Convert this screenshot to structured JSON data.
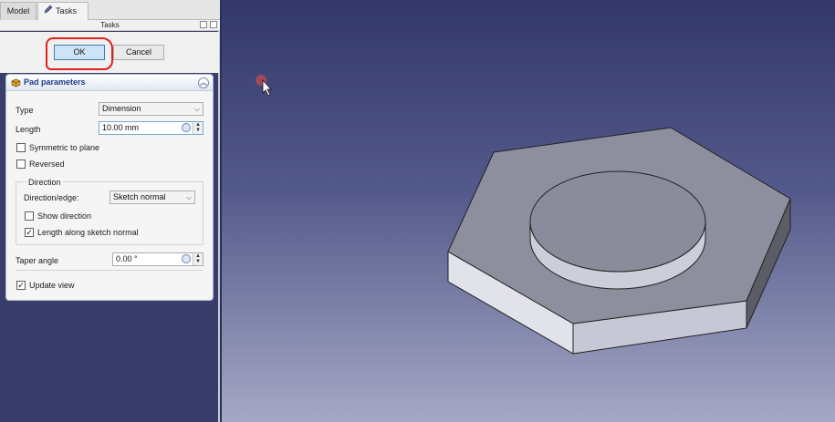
{
  "tabs": {
    "model": "Model",
    "tasks": "Tasks"
  },
  "panel": {
    "header": "Tasks"
  },
  "buttons": {
    "ok": "OK",
    "cancel": "Cancel"
  },
  "pad": {
    "title": "Pad parameters",
    "type_label": "Type",
    "type_value": "Dimension",
    "length_label": "Length",
    "length_value": "10.00 mm",
    "symmetric_label": "Symmetric to plane",
    "symmetric_checked": false,
    "reversed_label": "Reversed",
    "reversed_checked": false,
    "direction_group": "Direction",
    "direction_edge_label": "Direction/edge:",
    "direction_edge_value": "Sketch normal",
    "show_direction_label": "Show direction",
    "show_direction_checked": false,
    "length_along_label": "Length along sketch normal",
    "length_along_checked": true,
    "taper_label": "Taper angle",
    "taper_value": "0.00 °",
    "update_view_label": "Update view",
    "update_view_checked": true
  },
  "icons": {
    "tasks_tab": "pencil-icon",
    "pad": "pad-feature-icon",
    "collapse": "chevron-up-icon",
    "combo": "chevron-down-icon",
    "spin": "spin-arrows-icon",
    "expression": "gear-icon",
    "cursor": "mouse-cursor-icon"
  },
  "colors": {
    "highlight": "#e0201d",
    "viewport_top": "#33386a",
    "viewport_bottom": "#a5a8c5",
    "ok_button": "#cde4f7"
  }
}
